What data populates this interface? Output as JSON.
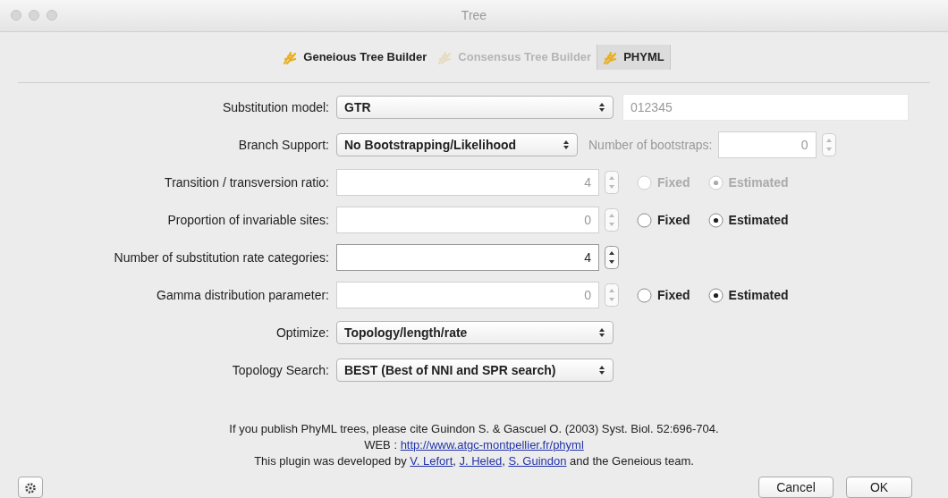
{
  "window": {
    "title": "Tree"
  },
  "tabs": [
    {
      "label": "Geneious Tree Builder",
      "selected": false,
      "disabled": false
    },
    {
      "label": "Consensus Tree Builder",
      "selected": false,
      "disabled": true
    },
    {
      "label": "PHYML",
      "selected": true,
      "disabled": false
    }
  ],
  "rows": [
    {
      "kind": "select",
      "label": "Substitution model:",
      "value": "GTR",
      "extra": {
        "kind": "text",
        "value": "012345"
      }
    },
    {
      "kind": "select",
      "label": "Branch Support:",
      "value": "No Bootstrapping/Likelihood",
      "extra": {
        "kind": "spinner",
        "label": "Number of bootstraps:",
        "value": "0",
        "disabled": true
      }
    },
    {
      "kind": "spinner",
      "label": "Transition / transversion ratio:",
      "value": "4",
      "disabled": true,
      "options": [
        {
          "label": "Fixed",
          "selected": false,
          "disabled": true
        },
        {
          "label": "Estimated",
          "selected": true,
          "disabled": true
        }
      ]
    },
    {
      "kind": "spinner",
      "label": "Proportion of invariable sites:",
      "value": "0",
      "disabled": true,
      "options": [
        {
          "label": "Fixed",
          "selected": false,
          "disabled": false
        },
        {
          "label": "Estimated",
          "selected": true,
          "disabled": false
        }
      ]
    },
    {
      "kind": "spinner",
      "label": "Number of substitution rate categories:",
      "value": "4",
      "disabled": false
    },
    {
      "kind": "spinner",
      "label": "Gamma distribution parameter:",
      "value": "0",
      "disabled": true,
      "options": [
        {
          "label": "Fixed",
          "selected": false,
          "disabled": false
        },
        {
          "label": "Estimated",
          "selected": true,
          "disabled": false
        }
      ]
    },
    {
      "kind": "select",
      "label": "Optimize:",
      "value": "Topology/length/rate"
    },
    {
      "kind": "select",
      "label": "Topology Search:",
      "value": "BEST (Best of NNI and SPR search)"
    }
  ],
  "citation": [
    [
      {
        "text": "If you publish PhyML trees, please cite Guindon S. & Gascuel O. (2003) Syst. Biol. 52:696-704."
      }
    ],
    [
      {
        "text": "WEB : "
      },
      {
        "link": "http://www.atgc-montpellier.fr/phyml"
      }
    ],
    [
      {
        "text": "This plugin was developed by "
      },
      {
        "link": "V. Lefort"
      },
      {
        "text": ", "
      },
      {
        "link": "J. Heled"
      },
      {
        "text": ", "
      },
      {
        "link": "S. Guindon"
      },
      {
        "text": " and the Geneious team."
      }
    ]
  ],
  "buttons": [
    {
      "label": "Cancel",
      "default": false
    },
    {
      "label": "OK",
      "default": false
    }
  ]
}
